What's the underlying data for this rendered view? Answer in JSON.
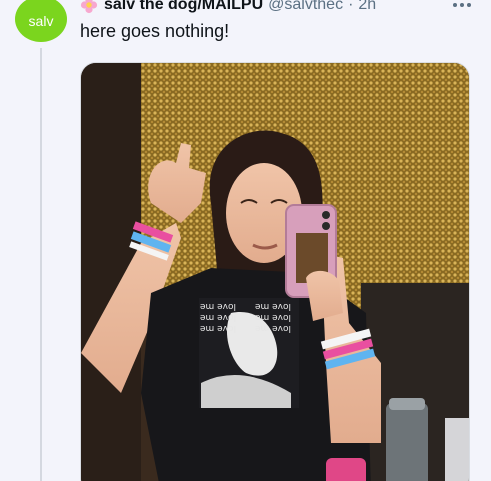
{
  "tweet": {
    "avatar_text": "salv",
    "display_name": "salv the dog/MAILPU",
    "handle": "@salvthec",
    "separator": "·",
    "time": "2h",
    "text": "here goes nothing!"
  },
  "colors": {
    "avatar_bg": "#7bd51e",
    "text": "#0f1419",
    "secondary": "#5b7083"
  },
  "media": {
    "shirt_print": [
      "love me",
      "love me",
      "love me",
      "love me",
      "love me",
      "love me"
    ]
  }
}
